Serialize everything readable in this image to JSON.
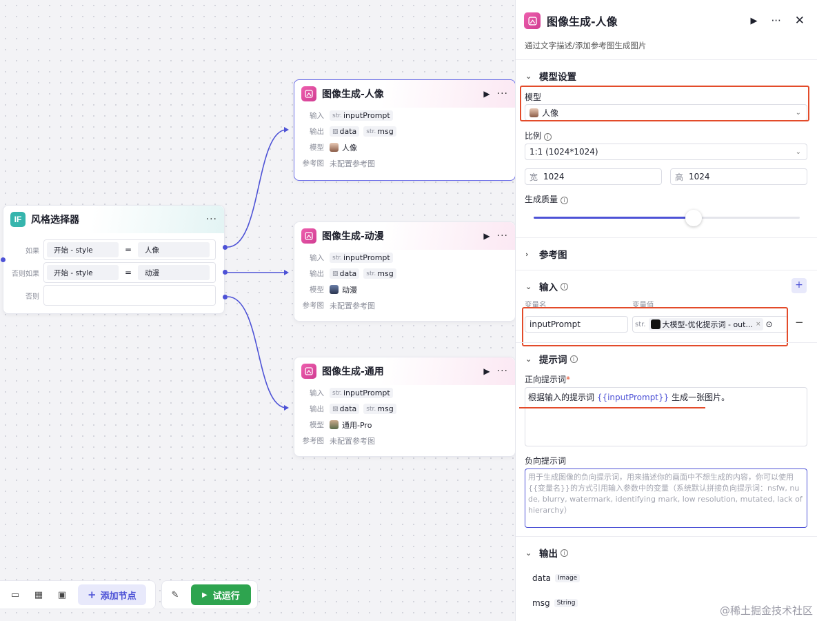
{
  "selector": {
    "title": "风格选择器",
    "icon_text": "IF",
    "conditions": [
      {
        "label": "如果",
        "left": "开始  -  style",
        "op": "=",
        "right": "人像"
      },
      {
        "label": "否则如果",
        "left": "开始  -  style",
        "op": "=",
        "right": "动漫"
      },
      {
        "label": "否则",
        "left": "",
        "op": "",
        "right": ""
      }
    ]
  },
  "nodes": [
    {
      "title": "图像生成-人像",
      "input_label": "输入",
      "input_type": "str.",
      "input_val": "inputPrompt",
      "output_label": "输出",
      "out1": "data",
      "out2_type": "str.",
      "out2": "msg",
      "model_label": "模型",
      "model": "人像",
      "ref_label": "参考图",
      "ref": "未配置参考图"
    },
    {
      "title": "图像生成-动漫",
      "input_label": "输入",
      "input_type": "str.",
      "input_val": "inputPrompt",
      "output_label": "输出",
      "out1": "data",
      "out2_type": "str.",
      "out2": "msg",
      "model_label": "模型",
      "model": "动漫",
      "ref_label": "参考图",
      "ref": "未配置参考图"
    },
    {
      "title": "图像生成-通用",
      "input_label": "输入",
      "input_type": "str.",
      "input_val": "inputPrompt",
      "output_label": "输出",
      "out1": "data",
      "out2_type": "str.",
      "out2": "msg",
      "model_label": "模型",
      "model": "通用-Pro",
      "ref_label": "参考图",
      "ref": "未配置参考图"
    }
  ],
  "toolbar": {
    "add_node": "添加节点",
    "run": "试运行"
  },
  "panel": {
    "title": "图像生成-人像",
    "desc": "通过文字描述/添加参考图生成图片",
    "model_section": "模型设置",
    "model_label": "模型",
    "model_value": "人像",
    "ratio_label": "比例",
    "ratio_value": "1:1 (1024*1024)",
    "width_label": "宽",
    "width_value": "1024",
    "height_label": "高",
    "height_value": "1024",
    "quality_label": "生成质量",
    "quality_level": 0.6,
    "ref_section": "参考图",
    "input_section": "输入",
    "var_name_header": "变量名",
    "var_value_header": "变量值",
    "var_name": "inputPrompt",
    "var_type": "str.",
    "var_ref": "大模型-优化提示词 - out...",
    "prompt_section": "提示词",
    "pos_label": "正向提示词",
    "pos_pre": "根据输入的提示词 ",
    "pos_var": "{{inputPrompt}}",
    "pos_post": " 生成一张图片。",
    "neg_label": "负向提示词",
    "neg_placeholder": "用于生成图像的负向提示词，用来描述你的画面中不想生成的内容，你可以使用{{变量名}}的方式引用输入参数中的变量（系统默认拼接负向提示词：nsfw, nude, blurry, watermark, identifying mark, low resolution, mutated, lack of hierarchy）",
    "output_section": "输出",
    "outputs": [
      {
        "name": "data",
        "type": "Image"
      },
      {
        "name": "msg",
        "type": "String"
      }
    ]
  },
  "watermark": "@稀土掘金技术社区",
  "colors": {
    "accent": "#4d52d6",
    "run": "#2ea44f",
    "highlight": "#e34b2a",
    "image_icon": "#e0509e"
  }
}
